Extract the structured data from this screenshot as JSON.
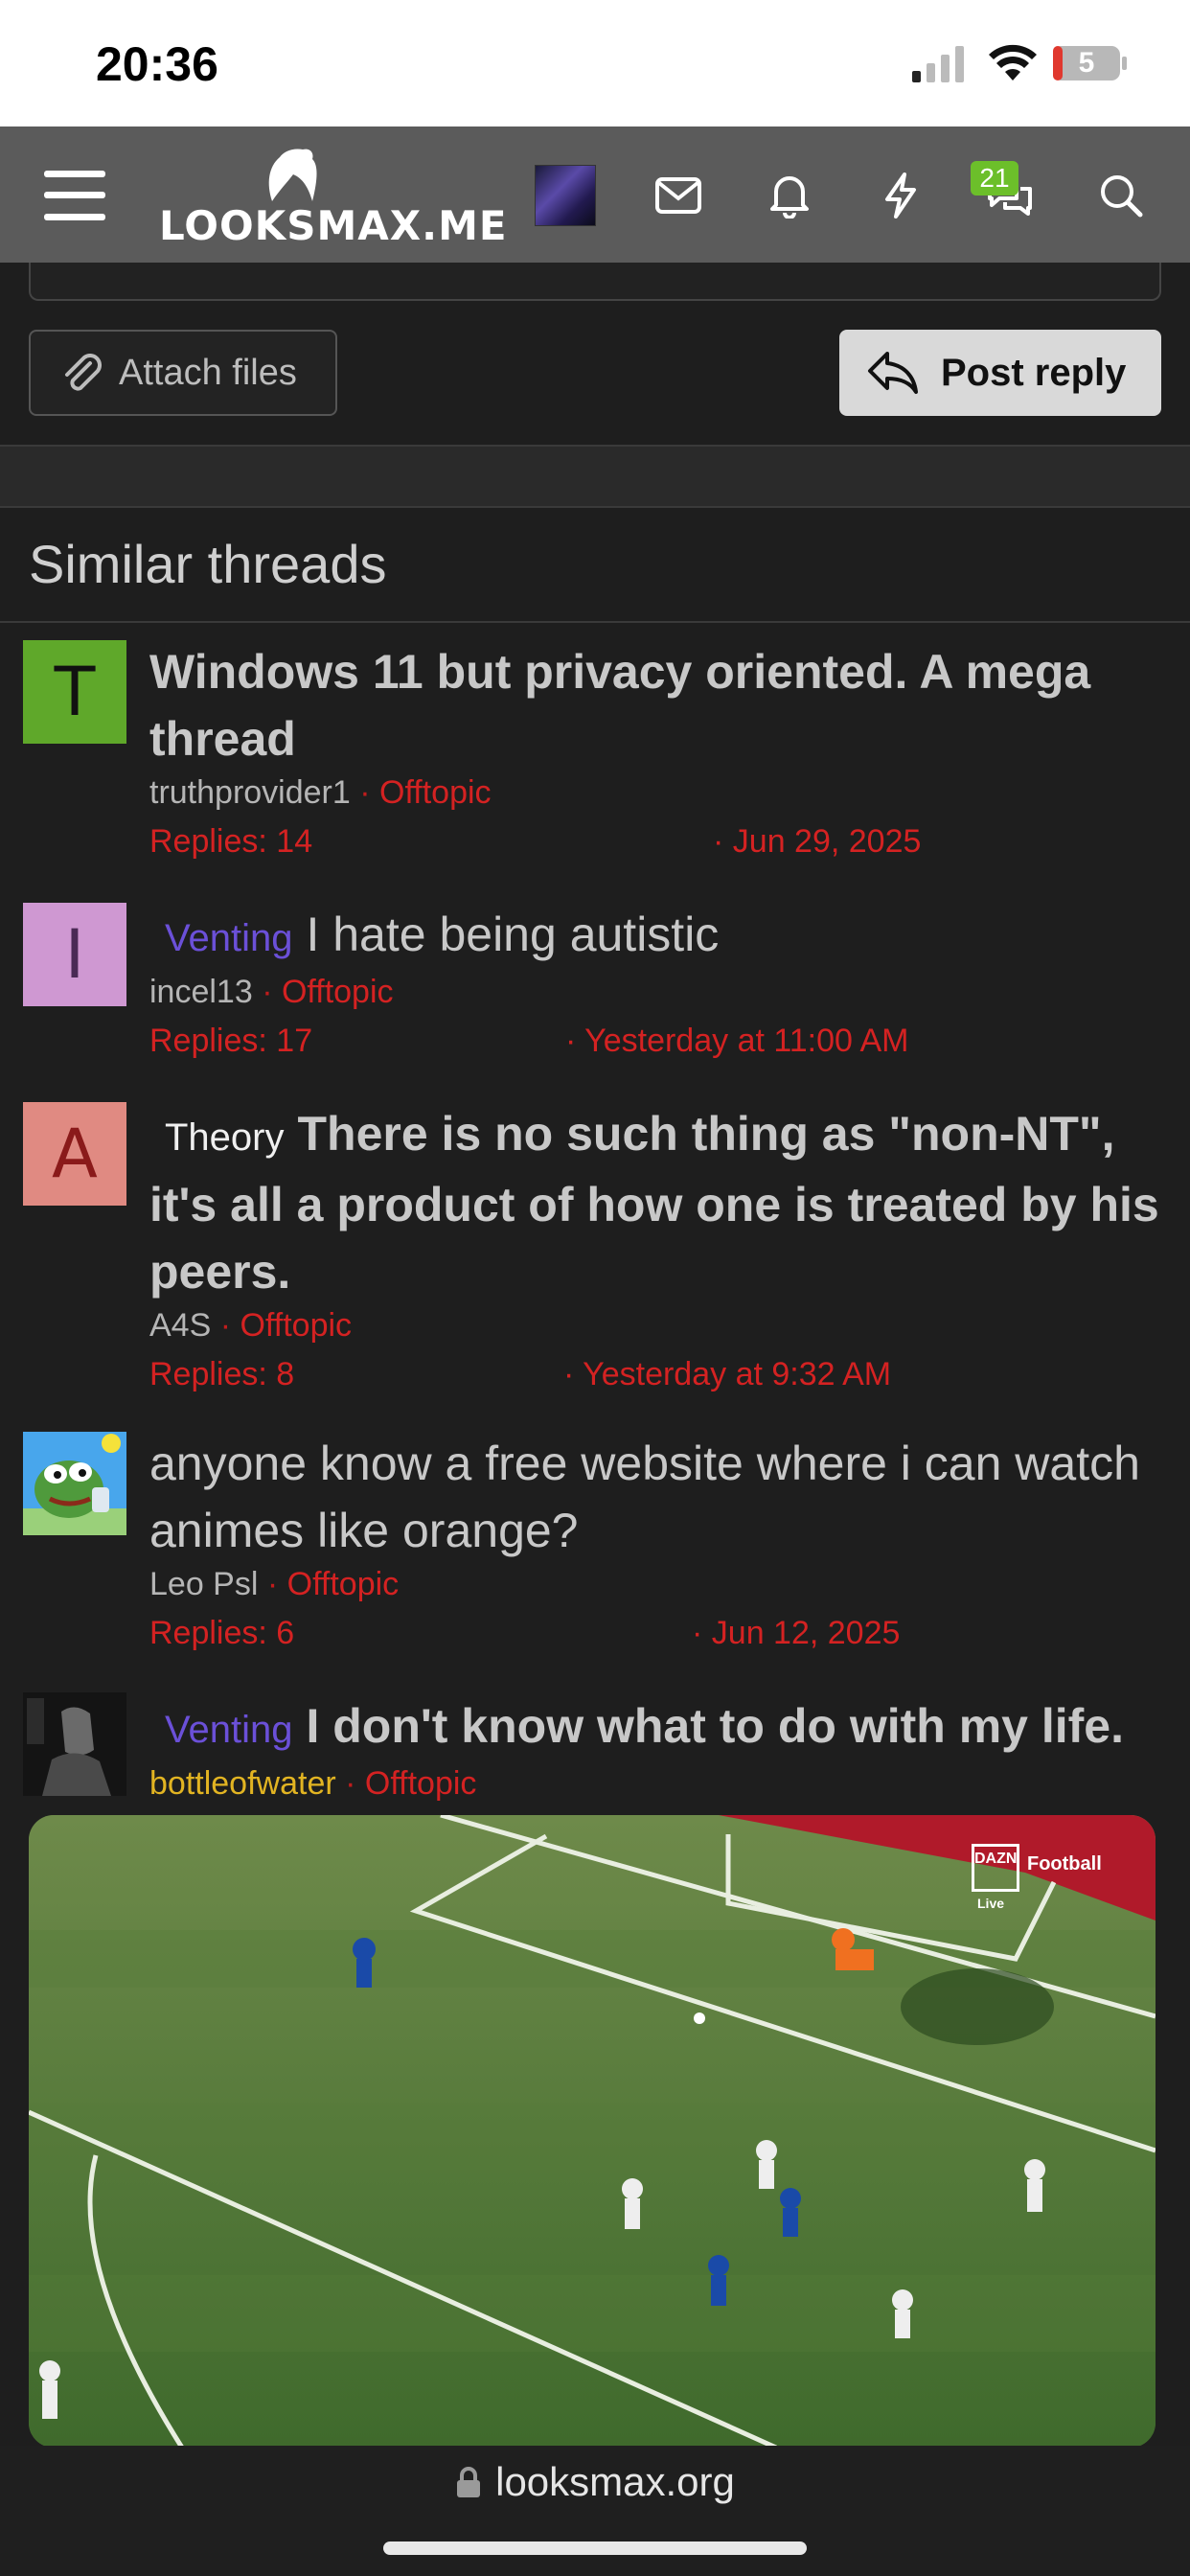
{
  "status_bar": {
    "time": "20:36",
    "battery": "5"
  },
  "nav": {
    "logo_text": "LOOKSMAX.ME",
    "conversations_badge": "21"
  },
  "editor": {
    "attach_label": "Attach files",
    "reply_label": "Post reply"
  },
  "similar_threads": {
    "heading": "Similar threads",
    "threads": [
      {
        "avatar_letter": "T",
        "avatar_color": "#5fa82a",
        "prefix": "",
        "title": "Windows 11 but privacy oriented. A mega thread",
        "author": "truthprovider1",
        "forum": "Offtopic",
        "replies": "Replies: 14",
        "date": "Jun 29, 2025"
      },
      {
        "avatar_letter": "I",
        "avatar_color": "#cf98d2",
        "prefix": "Venting",
        "title": "I hate being autistic",
        "author": "incel13",
        "forum": "Offtopic",
        "replies": "Replies: 17",
        "date": "Yesterday at 11:00 AM"
      },
      {
        "avatar_letter": "A",
        "avatar_color": "#e08a82",
        "prefix": "Theory",
        "title": "There is no such thing as \"non-NT\", it's all a product of how one is treated by his peers.",
        "author": "A4S",
        "forum": "Offtopic",
        "replies": "Replies: 8",
        "date": "Yesterday at 9:32 AM"
      },
      {
        "avatar_letter": "",
        "avatar_color": "",
        "prefix": "",
        "title": "anyone know a free website where i can watch animes like orange?",
        "author": "Leo Psl",
        "forum": "Offtopic",
        "replies": "Replies: 6",
        "date": "Jun 12, 2025"
      },
      {
        "avatar_letter": "",
        "avatar_color": "",
        "prefix": "Venting",
        "title": "I don't know what to do with my life.",
        "author": "bottleofwater",
        "forum": "Offtopic",
        "replies": "",
        "date": ""
      }
    ]
  },
  "video": {
    "broadcaster": "DAZN",
    "label": "Football",
    "live": "Live"
  },
  "browser": {
    "url": "looksmax.org"
  },
  "colors": {
    "accent_red": "#d42222",
    "venting": "#6b50d8",
    "gold": "#e2b422"
  }
}
